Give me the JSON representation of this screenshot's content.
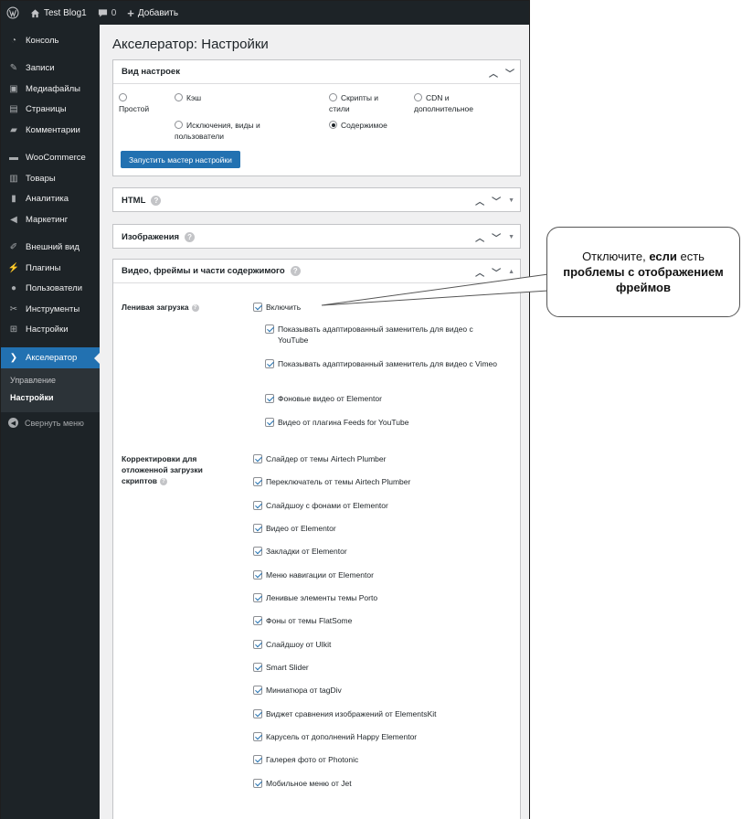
{
  "adminbar": {
    "site_name": "Test Blog1",
    "comments_count": "0",
    "add_new": "Добавить"
  },
  "sidebar": {
    "items": [
      {
        "label": "Консоль",
        "icon": "dashboard-icon"
      },
      {
        "label": "Записи",
        "icon": "pin-icon"
      },
      {
        "label": "Медиафайлы",
        "icon": "media-icon"
      },
      {
        "label": "Страницы",
        "icon": "page-icon"
      },
      {
        "label": "Комментарии",
        "icon": "comment-icon"
      },
      {
        "label": "WooCommerce",
        "icon": "woocommerce-icon"
      },
      {
        "label": "Товары",
        "icon": "archive-icon"
      },
      {
        "label": "Аналитика",
        "icon": "bar-chart-icon"
      },
      {
        "label": "Маркетинг",
        "icon": "megaphone-icon"
      },
      {
        "label": "Внешний вид",
        "icon": "brush-icon"
      },
      {
        "label": "Плагины",
        "icon": "plugin-icon"
      },
      {
        "label": "Пользователи",
        "icon": "user-icon"
      },
      {
        "label": "Инструменты",
        "icon": "wrench-icon"
      },
      {
        "label": "Настройки",
        "icon": "settings-icon"
      },
      {
        "label": "Акселератор",
        "icon": "accelerator-icon"
      }
    ],
    "submenu": [
      "Управление",
      "Настройки"
    ],
    "collapse": "Свернуть меню"
  },
  "page": {
    "title": "Акселератор: Настройки"
  },
  "view_box": {
    "title": "Вид настроек",
    "options": {
      "simple": "Простой",
      "cache": "Кэш",
      "scripts": "Скрипты и стили",
      "cdn": "CDN и дополнительное",
      "exclusions": "Исключения, виды и пользователи",
      "content": "Содержимое"
    },
    "selected": "Содержимое",
    "wizard_button": "Запустить мастер настройки"
  },
  "html_box": {
    "title": "HTML"
  },
  "images_box": {
    "title": "Изображения"
  },
  "video_box": {
    "title": "Видео, фреймы и части содержимого",
    "lazy_label": "Ленивая загрузка",
    "lazy_enable": "Включить",
    "lazy_options": [
      "Показывать адаптированный заменитель для видео с YouTube",
      "Показывать адаптированный заменитель для видео с Vimeo",
      "Фоновые видео от Elementor",
      "Видео от плагина Feeds for YouTube"
    ],
    "fix_label": "Корректировки для отложенной загрузки скриптов",
    "fix_options": [
      "Слайдер от темы Airtech Plumber",
      "Переключатель от темы Airtech Plumber",
      "Слайдшоу с фонами от Elementor",
      "Видео от Elementor",
      "Закладки от Elementor",
      "Меню навигации от Elementor",
      "Ленивые элементы темы Porto",
      "Фоны от темы FlatSome",
      "Слайдшоу от UIkit",
      "Smart Slider",
      "Миниатюра от tagDiv",
      "Виджет сравнения изображений от ElementsKit",
      "Карусель от дополнений Happy Elementor",
      "Галерея фото от Photonic",
      "Мобильное меню от Jet"
    ]
  },
  "callout": {
    "pre": "Отключите, ",
    "bold1": "если",
    "mid": " есть ",
    "bold2": "проблемы с отображением фреймов"
  },
  "colors": {
    "admin_dark": "#1d2327",
    "accent": "#2271b1",
    "background": "#f0f0f1"
  }
}
